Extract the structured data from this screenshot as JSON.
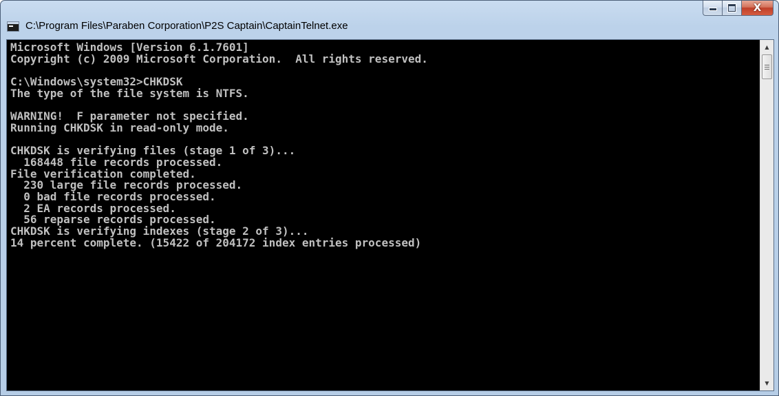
{
  "window": {
    "title": "C:\\Program Files\\Paraben Corporation\\P2S Captain\\CaptainTelnet.exe",
    "icon": "console-icon",
    "controls": {
      "minimize_icon": "minimize-icon",
      "maximize_icon": "maximize-icon",
      "close_icon": "close-icon",
      "close_glyph": "X"
    }
  },
  "console": {
    "lines": [
      "Microsoft Windows [Version 6.1.7601]",
      "Copyright (c) 2009 Microsoft Corporation.  All rights reserved.",
      "",
      "C:\\Windows\\system32>CHKDSK",
      "The type of the file system is NTFS.",
      "",
      "WARNING!  F parameter not specified.",
      "Running CHKDSK in read-only mode.",
      "",
      "CHKDSK is verifying files (stage 1 of 3)...",
      "  168448 file records processed.",
      "File verification completed.",
      "  230 large file records processed.",
      "  0 bad file records processed.",
      "  2 EA records processed.",
      "  56 reparse records processed.",
      "CHKDSK is verifying indexes (stage 2 of 3)...",
      "14 percent complete. (15422 of 204172 index entries processed)"
    ],
    "scrollbar": {
      "up_glyph": "▲",
      "down_glyph": "▼"
    }
  },
  "colors": {
    "console_background": "#000000",
    "console_text": "#c0c0c0",
    "close_button": "#c7432b"
  }
}
